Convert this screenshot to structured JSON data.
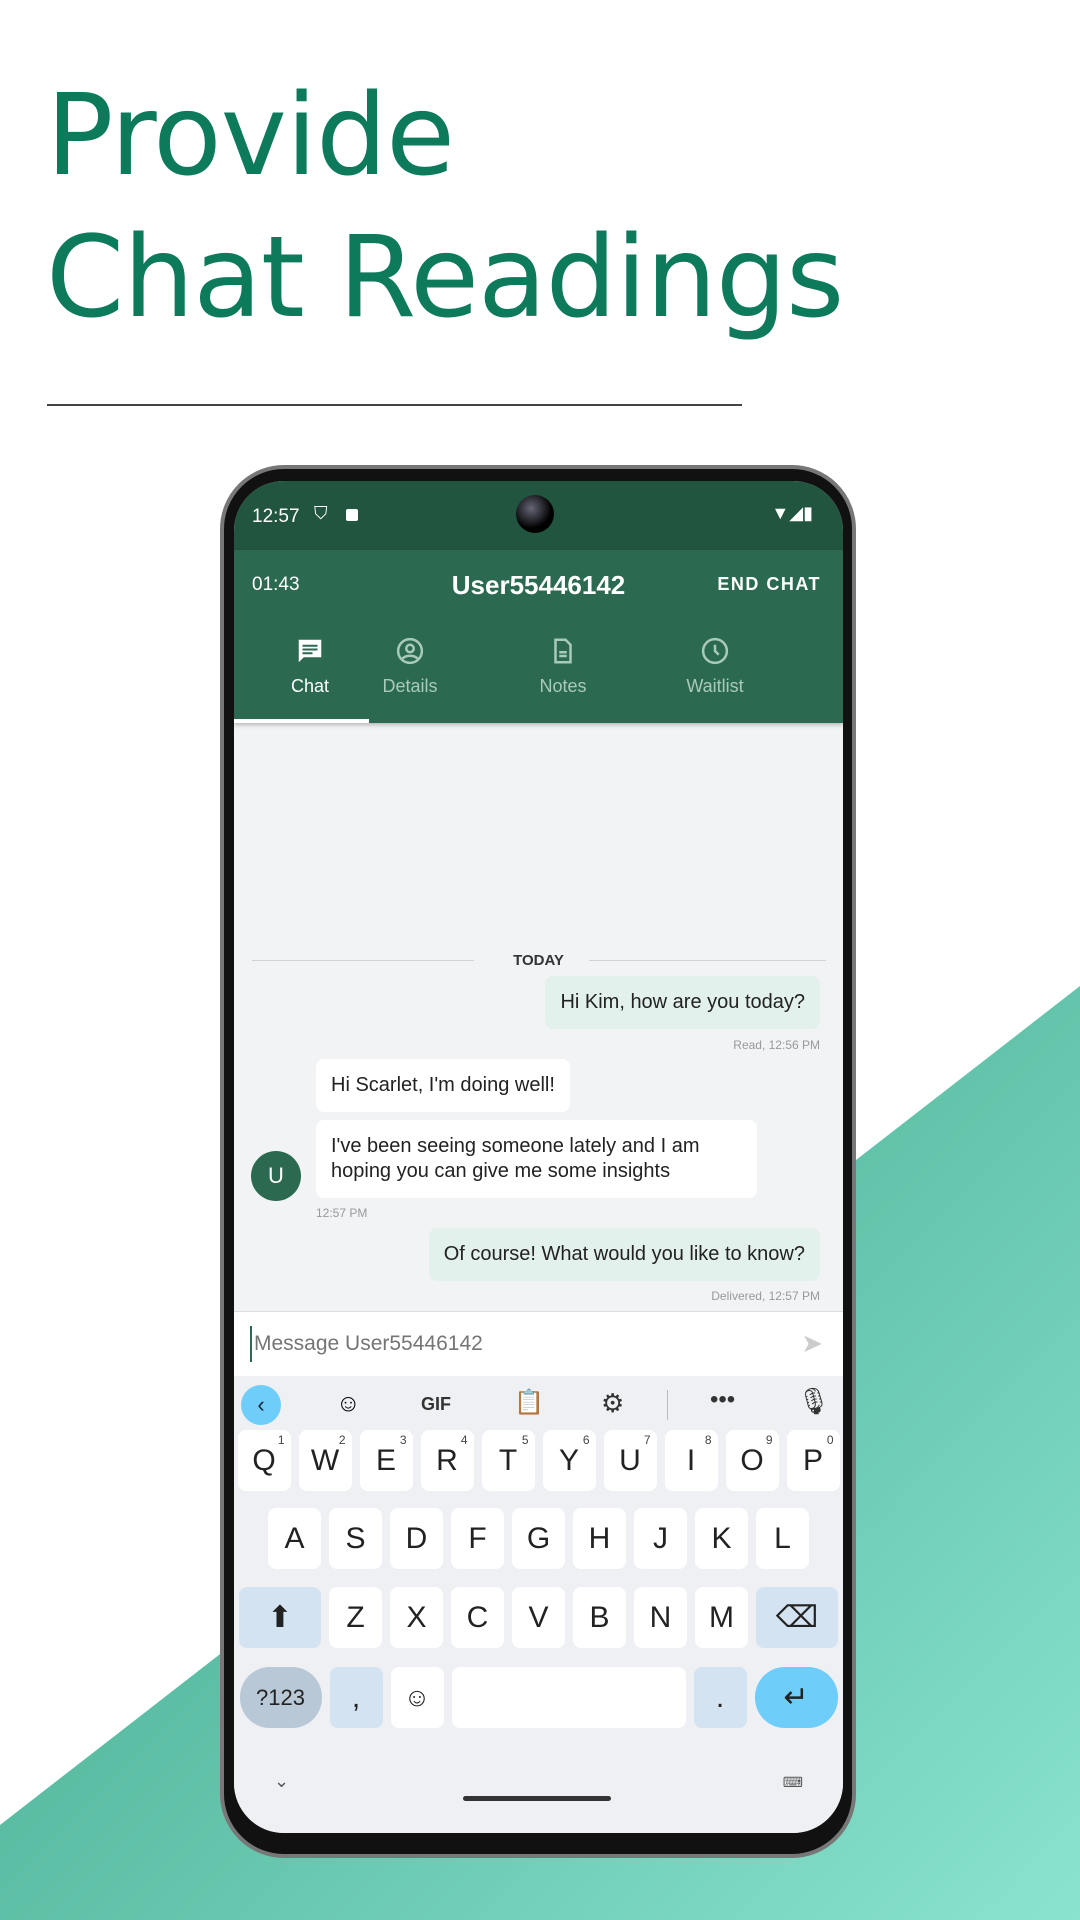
{
  "headline": {
    "line1": "Provide",
    "line2": "Chat Readings"
  },
  "status_bar": {
    "time": "12:57"
  },
  "app_bar": {
    "timer": "01:43",
    "title": "User55446142",
    "end_chat": "END CHAT"
  },
  "tabs": [
    {
      "label": "Chat",
      "icon": "chat-icon",
      "active": true
    },
    {
      "label": "Details",
      "icon": "account-circle-icon"
    },
    {
      "label": "Notes",
      "icon": "document-icon"
    },
    {
      "label": "Waitlist",
      "icon": "clock-icon"
    }
  ],
  "chat": {
    "date_divider": "TODAY",
    "avatar_letter": "U",
    "messages": [
      {
        "text": "Hi Kim, how are you today?",
        "caption": "Read, 12:56 PM",
        "dir": "out"
      },
      {
        "text": "Hi Scarlet, I'm doing well!",
        "dir": "in"
      },
      {
        "text": "I've been seeing someone lately and I am hoping you can give me some insights",
        "caption": "12:57 PM",
        "dir": "in"
      },
      {
        "text": "Of course! What would you like to know?",
        "caption": "Delivered, 12:57 PM",
        "dir": "out"
      }
    ]
  },
  "composer": {
    "placeholder": "Message User55446142"
  },
  "keyboard": {
    "gif": "GIF",
    "row1": [
      "Q",
      "W",
      "E",
      "R",
      "T",
      "Y",
      "U",
      "I",
      "O",
      "P"
    ],
    "row1_hints": [
      "1",
      "2",
      "3",
      "4",
      "5",
      "6",
      "7",
      "8",
      "9",
      "0"
    ],
    "row2": [
      "A",
      "S",
      "D",
      "F",
      "G",
      "H",
      "J",
      "K",
      "L"
    ],
    "row3": [
      "Z",
      "X",
      "C",
      "V",
      "B",
      "N",
      "M"
    ],
    "symbols": "?123",
    "comma": ",",
    "period": "."
  },
  "colors": {
    "brand": "#0d7a5c",
    "header": "#2b6a51",
    "accent_key": "#6fcdf9"
  }
}
